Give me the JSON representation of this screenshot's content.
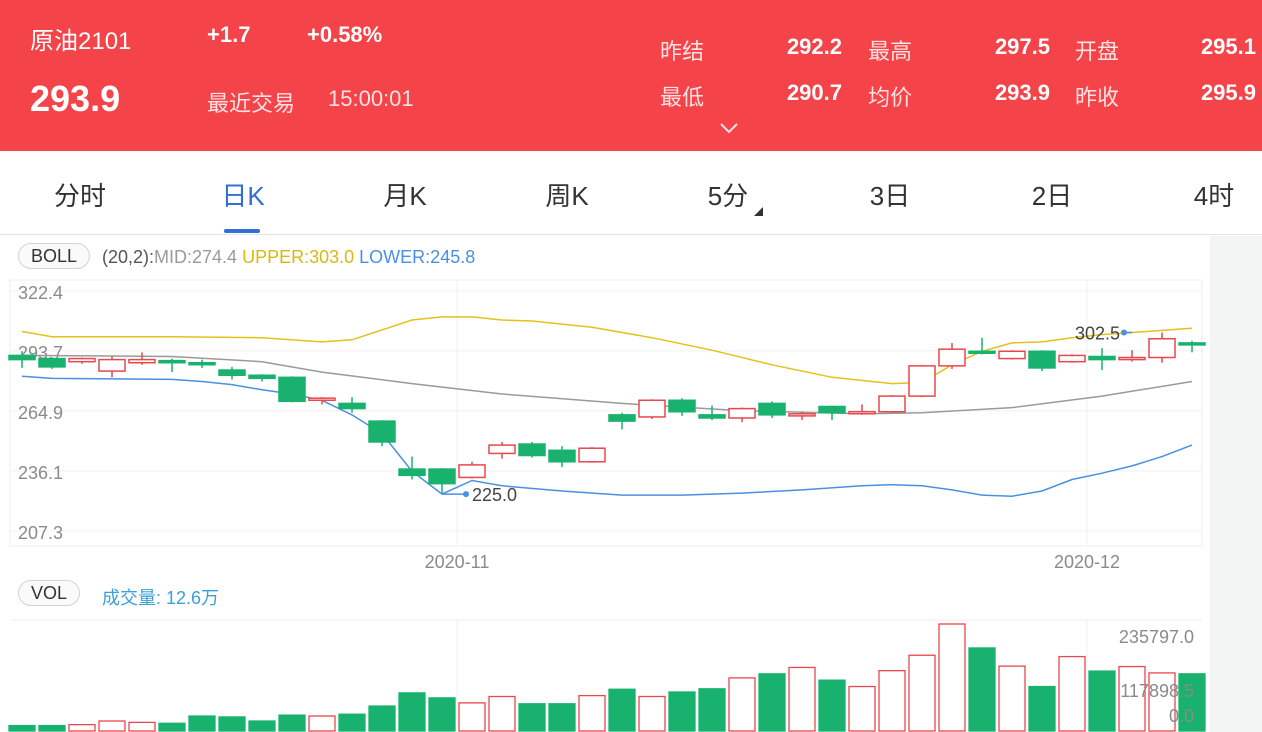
{
  "header": {
    "contract_name": "原油2101",
    "change": "+1.7",
    "change_pct": "+0.58%",
    "last_price": "293.9",
    "recent_trade_label": "最近交易",
    "recent_trade_time": "15:00:01",
    "stats": [
      {
        "label": "昨结",
        "value": "292.2"
      },
      {
        "label": "最高",
        "value": "297.5"
      },
      {
        "label": "开盘",
        "value": "295.1"
      },
      {
        "label": "最低",
        "value": "290.7"
      },
      {
        "label": "均价",
        "value": "293.9"
      },
      {
        "label": "昨收",
        "value": "295.9"
      }
    ],
    "expand_icon": "chevron-down-icon"
  },
  "tabs": [
    {
      "label": "分时",
      "active": false
    },
    {
      "label": "日K",
      "active": true
    },
    {
      "label": "月K",
      "active": false
    },
    {
      "label": "周K",
      "active": false
    },
    {
      "label": "5分",
      "active": false,
      "has_dropdown": true
    },
    {
      "label": "3日",
      "active": false
    },
    {
      "label": "2日",
      "active": false
    },
    {
      "label": "4时",
      "active": false
    }
  ],
  "colors": {
    "up": "#e8474c",
    "down": "#18b26e",
    "mid": "#9a9a9a",
    "upper": "#e2c21b",
    "lower": "#4a90e2",
    "header_bg": "#f5434a",
    "active_tab": "#2f6fd6",
    "vol_label": "#3aa0d8"
  },
  "boll": {
    "pill": "BOLL",
    "params": "(20,2):",
    "mid": "MID:274.4",
    "upper": "UPPER:303.0",
    "lower": "LOWER:245.8"
  },
  "vol": {
    "pill": "VOL",
    "label": "成交量: 12.6万"
  },
  "chart_data": [
    {
      "type": "candlestick",
      "indicator": "BOLL(20,2)",
      "y_ticks": [
        "322.4",
        "293.7",
        "264.9",
        "236.1",
        "207.3"
      ],
      "ylim": [
        207.3,
        322.4
      ],
      "x_ticks": [
        "2020-11",
        "2020-12"
      ],
      "x_tick_index": [
        14.5,
        35.5
      ],
      "annotations": [
        {
          "text": "302.5",
          "index": 37,
          "value": 302.5
        },
        {
          "text": "225.0",
          "index": 14,
          "value": 225.0
        }
      ],
      "candles": [
        {
          "o": 291.5,
          "c": 289.5,
          "h": 293.5,
          "l": 285.5
        },
        {
          "o": 290.0,
          "c": 286.0,
          "h": 290.5,
          "l": 285.0
        },
        {
          "o": 288.5,
          "c": 290.0,
          "h": 290.5,
          "l": 287.5
        },
        {
          "o": 284.0,
          "c": 289.5,
          "h": 291.0,
          "l": 281.0
        },
        {
          "o": 288.0,
          "c": 289.5,
          "h": 293.0,
          "l": 287.0
        },
        {
          "o": 289.0,
          "c": 288.0,
          "h": 290.0,
          "l": 283.5
        },
        {
          "o": 288.0,
          "c": 287.5,
          "h": 289.5,
          "l": 285.5
        },
        {
          "o": 284.5,
          "c": 282.0,
          "h": 286.0,
          "l": 280.0
        },
        {
          "o": 282.0,
          "c": 280.5,
          "h": 282.5,
          "l": 279.0
        },
        {
          "o": 281.0,
          "c": 269.5,
          "h": 281.5,
          "l": 269.0
        },
        {
          "o": 270.0,
          "c": 271.0,
          "h": 271.5,
          "l": 268.0
        },
        {
          "o": 268.5,
          "c": 266.0,
          "h": 271.5,
          "l": 264.0
        },
        {
          "o": 260.0,
          "c": 250.0,
          "h": 260.5,
          "l": 248.0
        },
        {
          "o": 237.0,
          "c": 234.0,
          "h": 243.0,
          "l": 232.0
        },
        {
          "o": 237.0,
          "c": 230.0,
          "h": 237.5,
          "l": 225.0
        },
        {
          "o": 233.0,
          "c": 239.0,
          "h": 240.5,
          "l": 232.5
        },
        {
          "o": 244.5,
          "c": 248.5,
          "h": 250.0,
          "l": 242.0
        },
        {
          "o": 249.0,
          "c": 243.5,
          "h": 250.0,
          "l": 242.5
        },
        {
          "o": 246.0,
          "c": 240.5,
          "h": 248.0,
          "l": 238.0
        },
        {
          "o": 240.5,
          "c": 247.0,
          "h": 247.5,
          "l": 240.0
        },
        {
          "o": 263.0,
          "c": 260.0,
          "h": 264.0,
          "l": 256.0
        },
        {
          "o": 262.0,
          "c": 270.0,
          "h": 270.5,
          "l": 261.0
        },
        {
          "o": 270.0,
          "c": 264.5,
          "h": 271.0,
          "l": 262.5
        },
        {
          "o": 263.0,
          "c": 261.5,
          "h": 267.5,
          "l": 260.5
        },
        {
          "o": 261.5,
          "c": 266.0,
          "h": 266.5,
          "l": 259.5
        },
        {
          "o": 268.5,
          "c": 263.0,
          "h": 269.5,
          "l": 261.5
        },
        {
          "o": 262.5,
          "c": 263.5,
          "h": 264.5,
          "l": 260.5
        },
        {
          "o": 267.0,
          "c": 264.0,
          "h": 267.5,
          "l": 260.5
        },
        {
          "o": 264.0,
          "c": 264.5,
          "h": 268.0,
          "l": 263.0
        },
        {
          "o": 264.5,
          "c": 272.0,
          "h": 272.5,
          "l": 264.0
        },
        {
          "o": 272.0,
          "c": 286.5,
          "h": 287.0,
          "l": 271.5
        },
        {
          "o": 286.5,
          "c": 294.5,
          "h": 297.5,
          "l": 285.0
        },
        {
          "o": 293.5,
          "c": 293.0,
          "h": 300.0,
          "l": 292.0
        },
        {
          "o": 290.0,
          "c": 293.5,
          "h": 294.0,
          "l": 289.5
        },
        {
          "o": 293.5,
          "c": 285.5,
          "h": 294.0,
          "l": 284.0
        },
        {
          "o": 288.5,
          "c": 291.5,
          "h": 292.0,
          "l": 288.0
        },
        {
          "o": 291.0,
          "c": 289.5,
          "h": 295.0,
          "l": 284.5
        },
        {
          "o": 289.5,
          "c": 290.5,
          "h": 294.0,
          "l": 288.5
        },
        {
          "o": 290.5,
          "c": 299.5,
          "h": 302.5,
          "l": 288.0
        },
        {
          "o": 297.5,
          "c": 297.0,
          "h": 298.5,
          "l": 293.0
        }
      ],
      "mid": [
        [
          0,
          291.5
        ],
        [
          5,
          291.0
        ],
        [
          8,
          288.5
        ],
        [
          10,
          283.5
        ],
        [
          13,
          278.0
        ],
        [
          16,
          273.0
        ],
        [
          20,
          268.5
        ],
        [
          24,
          265.0
        ],
        [
          28,
          263.5
        ],
        [
          30,
          264.0
        ],
        [
          33,
          266.5
        ],
        [
          36,
          272.0
        ],
        [
          39,
          279.0
        ]
      ],
      "upper": [
        [
          0,
          303.0
        ],
        [
          1,
          300.5
        ],
        [
          5,
          300.5
        ],
        [
          8,
          300.0
        ],
        [
          10,
          298.0
        ],
        [
          11,
          299.0
        ],
        [
          13,
          308.5
        ],
        [
          14,
          310.0
        ],
        [
          15,
          310.0
        ],
        [
          16,
          308.5
        ],
        [
          17,
          308.0
        ],
        [
          19,
          305.0
        ],
        [
          21,
          300.0
        ],
        [
          23,
          294.0
        ],
        [
          25,
          287.0
        ],
        [
          27,
          281.0
        ],
        [
          29,
          278.0
        ],
        [
          30,
          278.5
        ],
        [
          31,
          287.0
        ],
        [
          32,
          293.5
        ],
        [
          33,
          297.5
        ],
        [
          34,
          298.0
        ],
        [
          35,
          300.0
        ],
        [
          36,
          301.5
        ],
        [
          37,
          302.5
        ],
        [
          38,
          303.5
        ],
        [
          39,
          304.5
        ]
      ],
      "lower": [
        [
          0,
          281.5
        ],
        [
          1,
          280.5
        ],
        [
          5,
          280.0
        ],
        [
          6,
          279.0
        ],
        [
          7,
          277.5
        ],
        [
          8,
          275.0
        ],
        [
          9,
          273.0
        ],
        [
          10,
          270.0
        ],
        [
          11,
          263.0
        ],
        [
          12,
          254.0
        ],
        [
          13,
          236.0
        ],
        [
          14,
          225.0
        ],
        [
          15,
          231.5
        ],
        [
          16,
          229.0
        ],
        [
          18,
          226.5
        ],
        [
          20,
          224.5
        ],
        [
          22,
          224.5
        ],
        [
          24,
          225.5
        ],
        [
          26,
          227.0
        ],
        [
          28,
          229.0
        ],
        [
          29,
          229.5
        ],
        [
          30,
          229.0
        ],
        [
          31,
          227.0
        ],
        [
          32,
          224.5
        ],
        [
          33,
          224.0
        ],
        [
          34,
          226.5
        ],
        [
          35,
          232.0
        ],
        [
          36,
          235.0
        ],
        [
          37,
          238.5
        ],
        [
          38,
          243.0
        ],
        [
          39,
          248.5
        ]
      ]
    },
    {
      "type": "bar",
      "name": "VOL",
      "y_ticks": [
        "235797.0",
        "117898.5",
        "0.0"
      ],
      "ylim": [
        0,
        235797.0
      ],
      "values": [
        12000,
        12000,
        14000,
        22000,
        19000,
        17000,
        33000,
        31000,
        22000,
        35000,
        33000,
        37000,
        55000,
        84000,
        73000,
        62000,
        76000,
        60000,
        60000,
        78000,
        92000,
        76000,
        86000,
        93000,
        117000,
        126000,
        140000,
        112000,
        98000,
        133000,
        167000,
        235797,
        183000,
        143000,
        98000,
        164000,
        132000,
        142000,
        128000,
        126000
      ],
      "direction": [
        "down",
        "down",
        "up",
        "up",
        "up",
        "down",
        "down",
        "down",
        "down",
        "down",
        "up",
        "down",
        "down",
        "down",
        "down",
        "up",
        "up",
        "down",
        "down",
        "up",
        "down",
        "up",
        "down",
        "down",
        "up",
        "down",
        "up",
        "down",
        "up",
        "up",
        "up",
        "up",
        "down",
        "up",
        "down",
        "up",
        "down",
        "up",
        "up",
        "down"
      ]
    }
  ]
}
